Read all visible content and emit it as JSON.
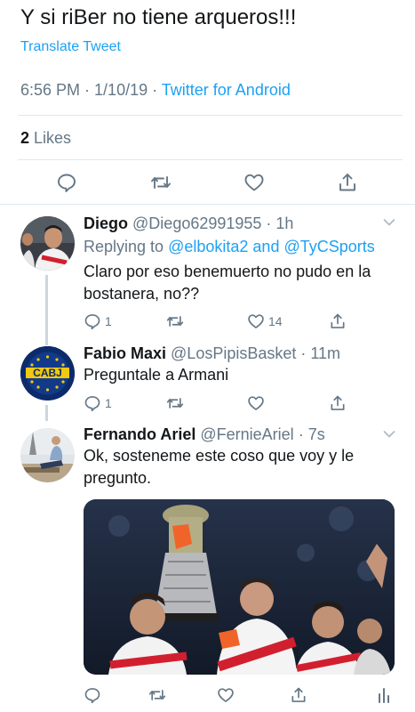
{
  "main_tweet": {
    "text": "Y si riBer no tiene arqueros!!!",
    "translate_label": "Translate Tweet",
    "time": "6:56 PM",
    "date": "1/10/19",
    "source": "Twitter for Android",
    "likes_count": "2",
    "likes_label": "Likes"
  },
  "replies": [
    {
      "name": "Diego",
      "handle": "@Diego62991955",
      "time": "1h",
      "replying_prefix": "Replying to",
      "replying_user1": "@elbokita2",
      "replying_and": "and",
      "replying_user2": "@TyCSports",
      "text": "Claro por eso benemuerto no pudo en la bostanera, no??",
      "reply_count": "1",
      "retweet_count": "",
      "like_count": "14"
    },
    {
      "name": "Fabio Maxi",
      "handle": "@LosPipisBasket",
      "time": "11m",
      "text": "Preguntale a Armani",
      "reply_count": "1",
      "avatar_text": "CABJ"
    },
    {
      "name": "Fernando Ariel",
      "handle": "@FernieAriel",
      "time": "7s",
      "text": "Ok, sosteneme este coso que voy y le pregunto."
    }
  ],
  "icons": {
    "reply": "reply-icon",
    "retweet": "retweet-icon",
    "like": "heart-icon",
    "share": "share-icon",
    "more": "chevron-down-icon",
    "analytics": "analytics-icon"
  },
  "colors": {
    "accent": "#1da1f2",
    "secondary_text": "#657786",
    "divider": "#e1e8ed",
    "thread_line": "#ccd6dd"
  }
}
